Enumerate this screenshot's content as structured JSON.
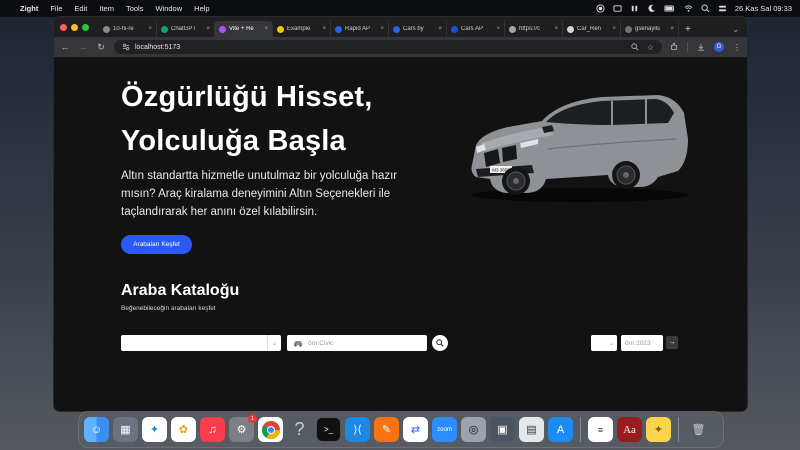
{
  "menubar": {
    "app_name": "Zight",
    "items": [
      "File",
      "Edit",
      "Item",
      "Tools",
      "Window",
      "Help"
    ],
    "clock": "26 Kas Sal  09:33"
  },
  "tabs": [
    {
      "label": "10-hi-re",
      "color": "#8a8a8a",
      "active": false
    },
    {
      "label": "ChatGPT",
      "color": "#10a37f",
      "active": false
    },
    {
      "label": "Vite + Re",
      "color": "#a855f7",
      "active": true
    },
    {
      "label": "Example",
      "color": "#f5c518",
      "active": false
    },
    {
      "label": "Rapid AP",
      "color": "#2563eb",
      "active": false
    },
    {
      "label": "Cars by",
      "color": "#2563eb",
      "active": false
    },
    {
      "label": "Cars AP",
      "color": "#1d4ed8",
      "active": false
    },
    {
      "label": "https://c",
      "color": "#9ca3af",
      "active": false
    },
    {
      "label": "Car_Ren",
      "color": "#d1d5db",
      "active": false
    },
    {
      "label": "gsenayils",
      "color": "#6b7280",
      "active": false
    }
  ],
  "address_bar": {
    "url": "localhost:5173"
  },
  "profile_initial": "G",
  "hero": {
    "title_line1": "Özgürlüğü Hisset,",
    "title_line2": "Yolculuğa Başla",
    "subtitle": "Altın standartta hizmetle unutulmaz bir yolculuğa hazır mısın? Araç kiralama deneyimini Altın Seçenekleri ile taçlandırarak her anını özel kılabilirsin.",
    "cta_label": "Arabaları Keşfet",
    "car_plate": "M3 3658"
  },
  "catalog": {
    "title": "Araba Kataloğu",
    "subtitle": "Beğenebileceğin arabaları keşfet",
    "brand_value": "",
    "model_placeholder": "örn:Civic",
    "year_placeholder": "örn:2023"
  },
  "colors": {
    "accent": "#2b59f5",
    "page_bg": "#121212"
  },
  "dock": {
    "calendar_badge": "1"
  }
}
